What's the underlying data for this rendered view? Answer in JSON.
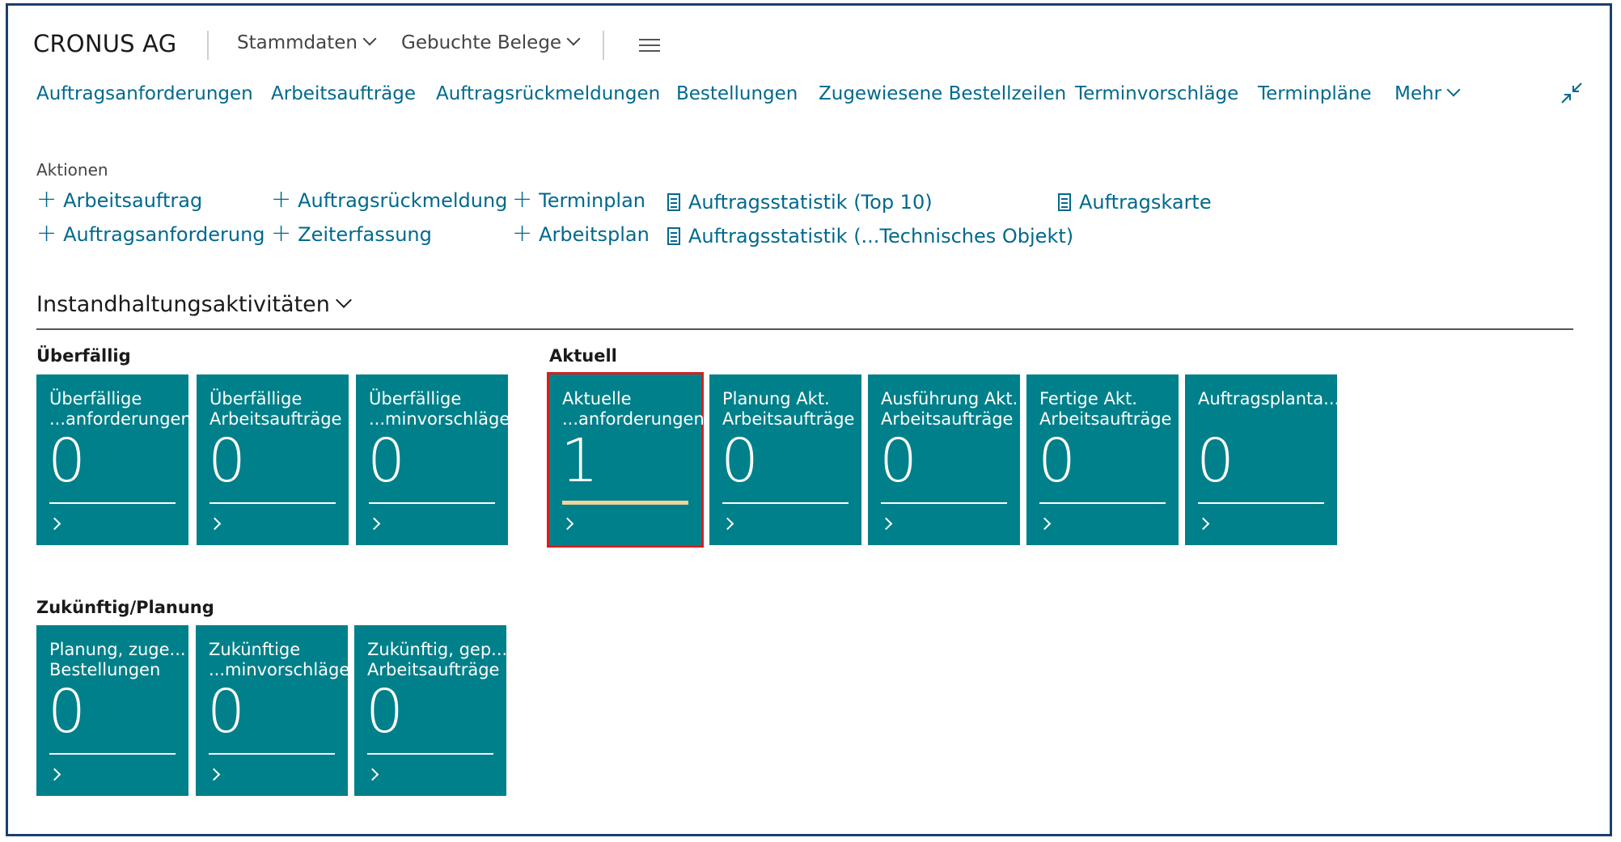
{
  "header": {
    "company": "CRONUS AG",
    "menus": [
      {
        "label": "Stammdaten"
      },
      {
        "label": "Gebuchte Belege"
      }
    ]
  },
  "nav_links": [
    "Auftragsanforderungen",
    "Arbeitsaufträge",
    "Auftragsrückmeldungen",
    "Bestellungen",
    "Zugewiesene Bestellzeilen",
    "Terminvorschläge",
    "Terminpläne",
    "Mehr"
  ],
  "actions": {
    "label": "Aktionen",
    "items": [
      {
        "icon": "plus-icon",
        "label": "Arbeitsauftrag"
      },
      {
        "icon": "plus-icon",
        "label": "Auftragsanforderung"
      },
      {
        "icon": "plus-icon",
        "label": "Auftragsrückmeldung"
      },
      {
        "icon": "plus-icon",
        "label": "Zeiterfassung"
      },
      {
        "icon": "plus-icon",
        "label": "Terminplan"
      },
      {
        "icon": "plus-icon",
        "label": "Arbeitsplan"
      },
      {
        "icon": "report-icon",
        "label": "Auftragsstatistik (Top 10)"
      },
      {
        "icon": "report-icon",
        "label": "Auftragsstatistik (...Technisches Objekt)"
      },
      {
        "icon": "report-icon",
        "label": "Auftragskarte"
      }
    ]
  },
  "activities": {
    "title": "Instandhaltungsaktivitäten",
    "groups": [
      {
        "title": "Überfällig",
        "tiles": [
          {
            "line1": "Überfällige",
            "line2": "...anforderungen",
            "value": "0"
          },
          {
            "line1": "Überfällige",
            "line2": "Arbeitsaufträge",
            "value": "0"
          },
          {
            "line1": "Überfällige",
            "line2": "...minvorschläge",
            "value": "0"
          }
        ]
      },
      {
        "title": "Aktuell",
        "tiles": [
          {
            "line1": "Aktuelle",
            "line2": "...anforderungen",
            "value": "1"
          },
          {
            "line1": "Planung Akt.",
            "line2": "Arbeitsaufträge",
            "value": "0"
          },
          {
            "line1": "Ausführung Akt.",
            "line2": "Arbeitsaufträge",
            "value": "0"
          },
          {
            "line1": "Fertige Akt.",
            "line2": "Arbeitsaufträge",
            "value": "0"
          },
          {
            "line1": "Auftragsplanta...",
            "line2": "",
            "value": "0"
          }
        ]
      },
      {
        "title": "Zukünftig/Planung",
        "tiles": [
          {
            "line1": "Planung, zuge...",
            "line2": "Bestellungen",
            "value": "0"
          },
          {
            "line1": "Zukünftige",
            "line2": "...minvorschläge",
            "value": "0"
          },
          {
            "line1": "Zukünftig, gep...",
            "line2": "Arbeitsaufträge",
            "value": "0"
          }
        ]
      }
    ]
  },
  "colors": {
    "tile": "#00808a",
    "link": "#00698d",
    "selected_outline": "#d42020",
    "warning_bar": "#f3d29a"
  }
}
